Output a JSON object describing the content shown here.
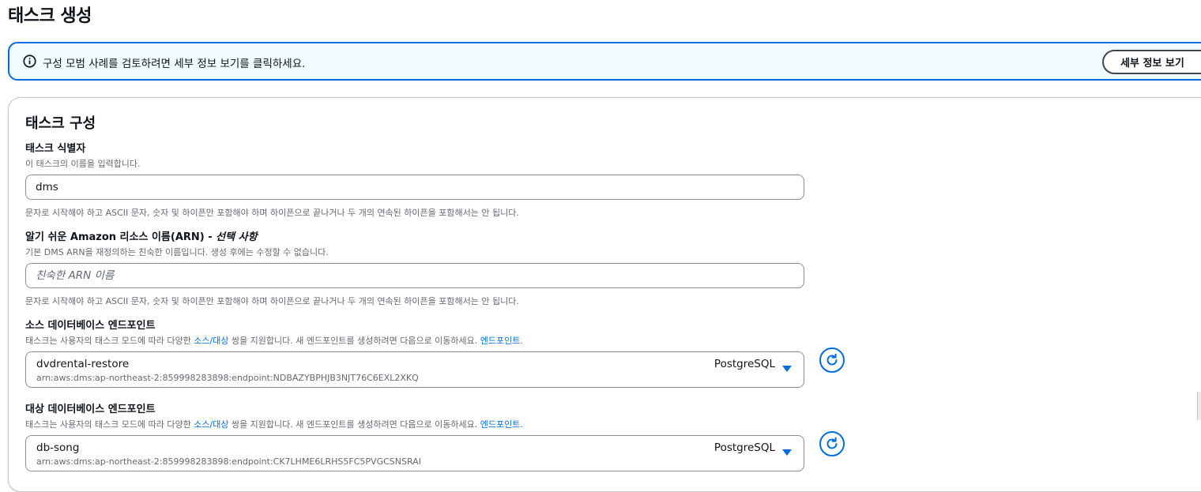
{
  "page": {
    "title": "태스크 생성"
  },
  "info": {
    "text": "구성 모범 사례를 검토하려면 세부 정보 보기를 클릭하세요.",
    "button": "세부 정보 보기"
  },
  "panel": {
    "title": "태스크 구성",
    "identifier": {
      "label": "태스크 식별자",
      "description": "이 태스크의 이름을 입력합니다.",
      "value": "dms",
      "constraint": "문자로 시작해야 하고 ASCII 문자, 숫자 및 하이픈만 포함해야 하며 하이픈으로 끝나거나 두 개의 연속된 하이픈을 포함해서는 안 됩니다."
    },
    "arn": {
      "label": "알기 쉬운 Amazon 리소스 이름(ARN) - ",
      "label_optional": "선택 사항",
      "description": "기본 DMS ARN을 재정의하는 친숙한 이름입니다. 생성 후에는 수정할 수 없습니다.",
      "placeholder": "친숙한 ARN 이름",
      "constraint": "문자로 시작해야 하고 ASCII 문자, 숫자 및 하이픈만 포함해야 하며 하이픈으로 끝나거나 두 개의 연속된 하이픈을 포함해서는 안 됩니다."
    },
    "source": {
      "label": "소스 데이터베이스 엔드포인트",
      "desc_pre": "태스크는 사용자의 태스크 모드에 따라 다양한 ",
      "desc_link1": "소스/대상",
      "desc_mid": " 쌍을 지원합니다. 새 엔드포인트를 생성하려면 다음으로 이동하세요. ",
      "desc_link2": "엔드포인트",
      "desc_post": ".",
      "selected": "dvdrental-restore",
      "arn": "arn:aws:dms:ap-northeast-2:859998283898:endpoint:NDBAZYBPHJB3NJT76C6EXL2XKQ",
      "engine": "PostgreSQL"
    },
    "target": {
      "label": "대상 데이터베이스 엔드포인트",
      "desc_pre": "태스크는 사용자의 태스크 모드에 따라 다양한 ",
      "desc_link1": "소스/대상",
      "desc_mid": " 쌍을 지원합니다. 새 엔드포인트를 생성하려면 다음으로 이동하세요. ",
      "desc_link2": "엔드포인트",
      "desc_post": ".",
      "selected": "db-song",
      "arn": "arn:aws:dms:ap-northeast-2:859998283898:endpoint:CK7LHME6LRHS5FC5PVGCSNSRAI",
      "engine": "PostgreSQL"
    }
  },
  "icons": {
    "info": "info-circle-icon",
    "refresh": "refresh-icon",
    "caret": "caret-down-icon"
  },
  "colors": {
    "accent": "#006ce0",
    "banner_bg": "#f0fbff",
    "text": "#0f141a",
    "muted": "#656871"
  }
}
